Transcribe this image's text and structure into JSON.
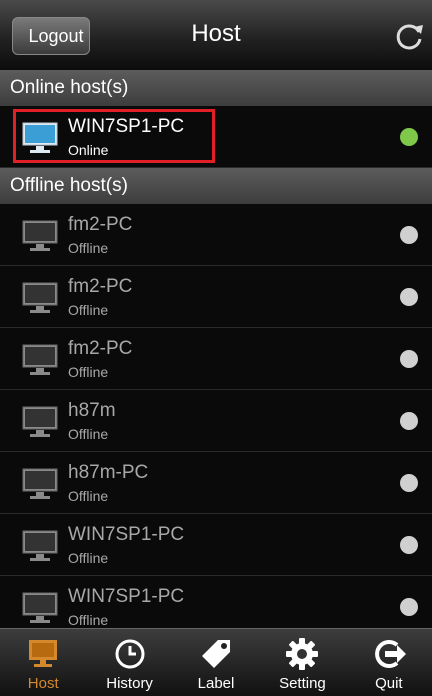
{
  "header": {
    "back_label": "Logout",
    "title": "Host",
    "refresh_icon": "refresh-icon"
  },
  "sections": {
    "online_label": "Online host(s)",
    "offline_label": "Offline host(s)"
  },
  "online_hosts": [
    {
      "name": "WIN7SP1-PC",
      "status": "Online"
    }
  ],
  "offline_hosts": [
    {
      "name": "fm2-PC",
      "status": "Offline"
    },
    {
      "name": "fm2-PC",
      "status": "Offline"
    },
    {
      "name": "fm2-PC",
      "status": "Offline"
    },
    {
      "name": "h87m",
      "status": "Offline"
    },
    {
      "name": "h87m-PC",
      "status": "Offline"
    },
    {
      "name": "WIN7SP1-PC",
      "status": "Offline"
    },
    {
      "name": "WIN7SP1-PC",
      "status": "Offline"
    }
  ],
  "colors": {
    "online_dot": "#7ec94a",
    "offline_dot": "#d0d0d0",
    "highlight": "#e01f26",
    "active_tab": "#d4892c"
  },
  "tabs": [
    {
      "label": "Host",
      "icon": "monitor-icon"
    },
    {
      "label": "History",
      "icon": "clock-icon"
    },
    {
      "label": "Label",
      "icon": "tag-icon"
    },
    {
      "label": "Setting",
      "icon": "gear-icon"
    },
    {
      "label": "Quit",
      "icon": "exit-icon"
    }
  ]
}
